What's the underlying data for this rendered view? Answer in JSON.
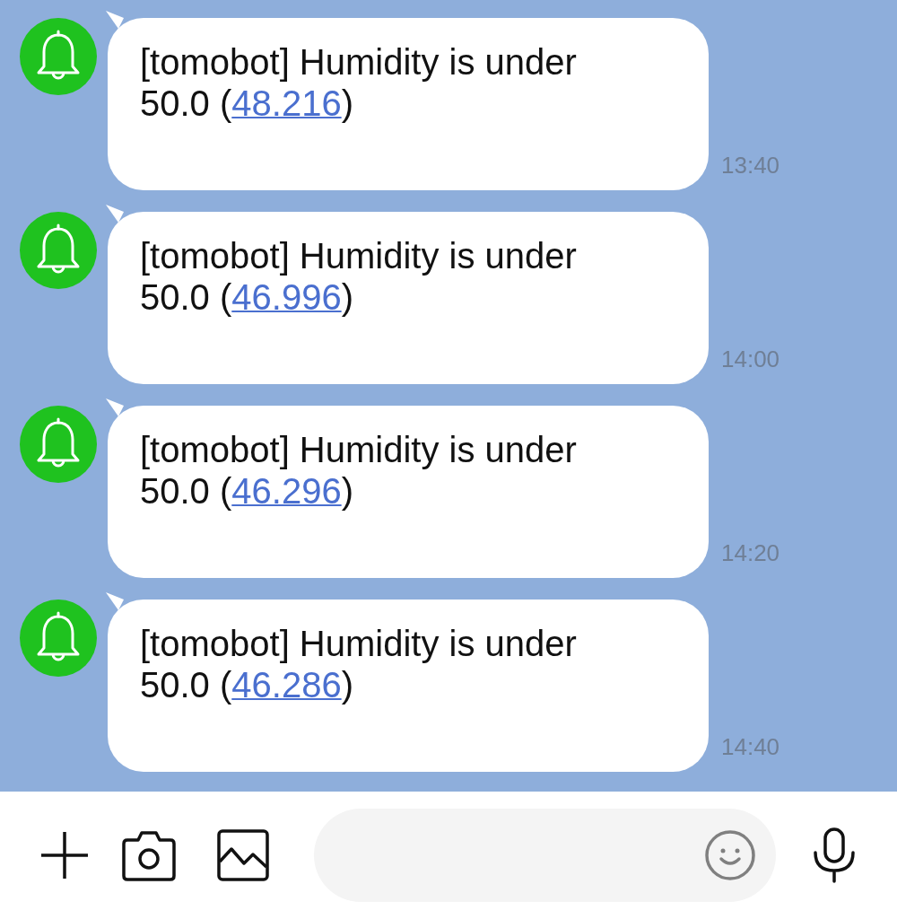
{
  "messages": [
    {
      "text": "[tomobot] Humidity is under 50.0 (",
      "link": "48.216",
      "text_end": ")",
      "time": "13:40"
    },
    {
      "text": "[tomobot] Humidity is under 50.0 (",
      "link": "46.996",
      "text_end": ")",
      "time": "14:00"
    },
    {
      "text": "[tomobot] Humidity is under 50.0 (",
      "link": "46.296",
      "text_end": ")",
      "time": "14:20"
    },
    {
      "text": "[tomobot] Humidity is under 50.0 (",
      "link": "46.286",
      "text_end": ")",
      "time": "14:40"
    }
  ]
}
